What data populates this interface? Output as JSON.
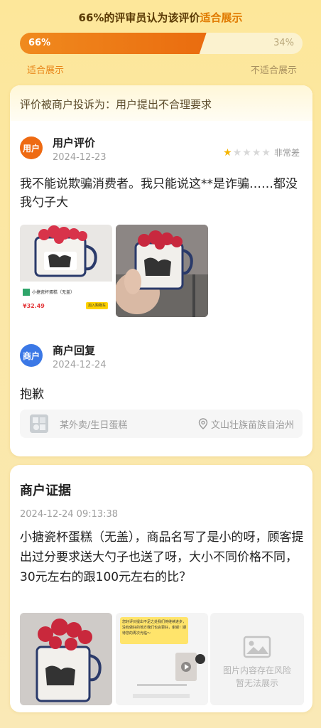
{
  "vote": {
    "title_prefix": "66%的评审员认为该评价",
    "title_highlight": "适合展示",
    "agree_pct_label": "66%",
    "disagree_pct_label": "34%",
    "agree_fraction": 0.66,
    "agree_label": "适合展示",
    "disagree_label": "不适合展示",
    "colors": {
      "agree": "#ee6a12",
      "disagree": "#fbf2cf"
    }
  },
  "complaint": {
    "text": "评价被商户投诉为：用户提出不合理要求"
  },
  "user_review": {
    "avatar_text": "用户",
    "name": "用户评价",
    "date": "2024-12-23",
    "stars": 1,
    "max_stars": 5,
    "rating_text": "非常差",
    "text": "我不能说欺骗消费者。我只能说这**是诈骗……都没我勺子大",
    "photos": [
      "strawberry-cake-cup-listing",
      "strawberry-cake-cup-hand"
    ]
  },
  "listing_thumb": {
    "product_name": "小搪瓷杯蛋糕（无盖）",
    "price": "¥32.49",
    "button": "加入购物车"
  },
  "merchant_reply": {
    "avatar_text": "商户",
    "name": "商户回复",
    "date": "2024-12-24",
    "text": "抱歉"
  },
  "store": {
    "name": "某外卖/生日蛋糕",
    "location": "文山壮族苗族自治州"
  },
  "evidence": {
    "title": "商户证据",
    "timestamp": "2024-12-24 09:13:38",
    "text": "小搪瓷杯蛋糕（无盖），商品名写了是小的呀，顾客提出过分要求送大勺子也送了呀，大小不同价格不同，30元左右的跟100元左右的比？",
    "chat_snippet": "您好评价提出不足之处我们将继续进步，没有做好的地方我们也会更好，谢谢！期待您的再次光临～",
    "risk_text_line1": "图片内容存在风险",
    "risk_text_line2": "暂无法展示"
  }
}
